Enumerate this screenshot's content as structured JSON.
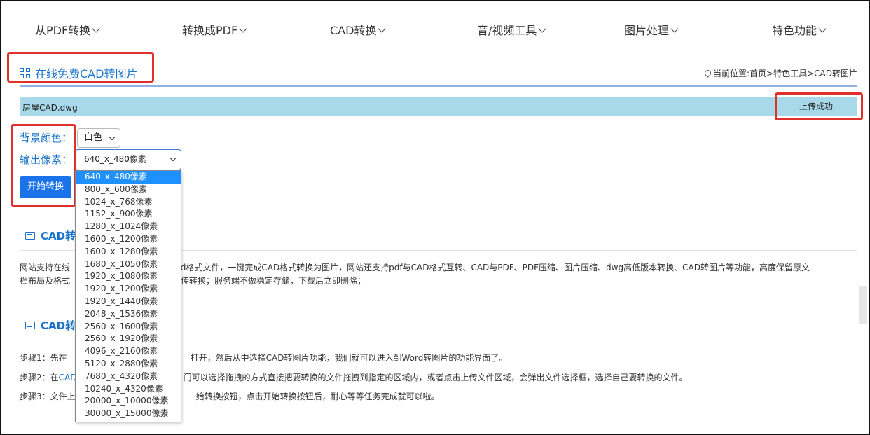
{
  "nav": {
    "items": [
      {
        "label": "从PDF转换"
      },
      {
        "label": "转换成PDF"
      },
      {
        "label": "CAD转换"
      },
      {
        "label": "音/视频工具"
      },
      {
        "label": "图片处理"
      },
      {
        "label": "特色功能"
      }
    ]
  },
  "page": {
    "title": "在线免费CAD转图片",
    "breadcrumb": "当前位置:首页>特色工具>CAD转图片"
  },
  "file": {
    "name": "房屋CAD.dwg",
    "status": "上传成功"
  },
  "form": {
    "bg_label": "背景颜色：",
    "bg_value": "白色",
    "px_label": "输出像素：",
    "px_value": "640_x_480像素",
    "start_label": "开始转换"
  },
  "dropdown": {
    "options": [
      "640_x_480像素",
      "800_x_600像素",
      "1024_x_768像素",
      "1152_x_900像素",
      "1280_x_1024像素",
      "1600_x_1200像素",
      "1600_x_1280像素",
      "1680_x_1050像素",
      "1920_x_1080像素",
      "1920_x_1200像素",
      "1920_x_1440像素",
      "2048_x_1536像素",
      "2560_x_1600像素",
      "2560_x_1920像素",
      "4096_x_2160像素",
      "5120_x_2880像素",
      "7680_x_4320像素",
      "10240_x_4320像素",
      "20000_x_10000像素",
      "30000_x_15000像素"
    ],
    "selected_index": 0
  },
  "section1": {
    "heading": "CAD转",
    "para_line1_a": "网站支持在线",
    "para_line1_b": "rd格式文件，一键完成CAD格式转换为图片，网站还支持pdf与CAD格式互转、CAD与PDF、PDF压缩、图片压缩、dwg高低版本转换、CAD转图片等功能，高度保留原文",
    "para_line2_a": "档布局及格式",
    "para_line2_b": "上传转换；服务端不做稳定存储，下载后立即删除；"
  },
  "section2": {
    "heading": "CAD转",
    "step1_a": "步骤1：先在",
    "step1_b": "打开，然后从中选择CAD转图片功能，我们就可以进入到Word转图片的功能界面了。",
    "step2_a": "步骤2：在",
    "step2_link": "CAD",
    "step2_b": "门可以选择拖拽的方式直接把要转换的文件拖拽到指定的区域内，或者点击上传文件区域，会弹出文件选择框，选择自己要转换的文件。",
    "step3_a": "步骤3：文件上",
    "step3_b": "始转换按钮，点击开始转换按钮后，耐心等等任务完成就可以啦。"
  }
}
